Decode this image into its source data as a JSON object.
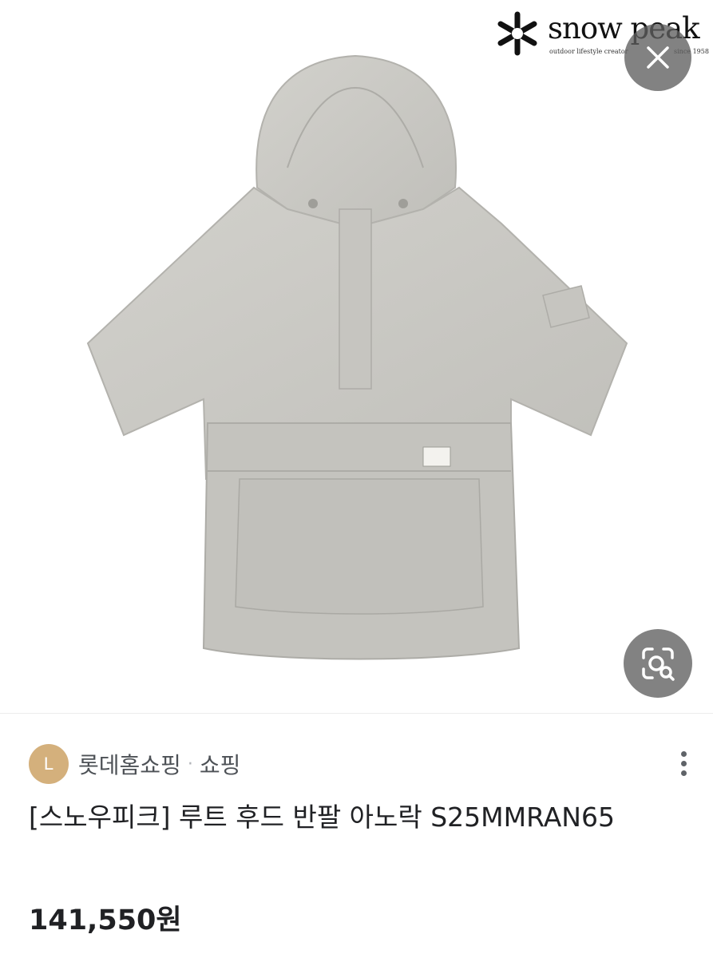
{
  "brand_logo": {
    "wordmark": "snow peak",
    "tagline": "outdoor lifestyle creator",
    "since": "since 1958"
  },
  "icons": {
    "close": "close-icon",
    "lens": "lens-search-icon",
    "more": "more-vert-icon"
  },
  "source": {
    "avatar_letter": "L",
    "avatar_color": "#d4b07c",
    "name": "롯데홈쇼핑",
    "separator": "·",
    "type": "쇼핑"
  },
  "product": {
    "title": "[스노우피크] 루트 후드 반팔 아노락 S25MMRAN65",
    "price": "141,550원",
    "jacket_color": "#c9c8c3"
  }
}
